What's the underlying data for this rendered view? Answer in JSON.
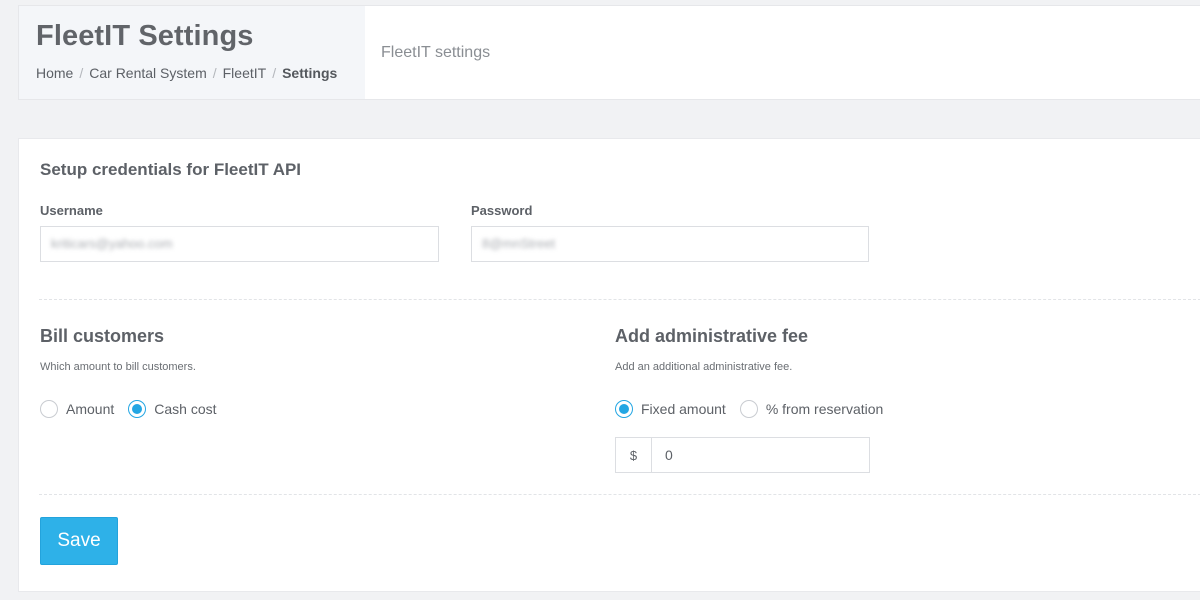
{
  "header": {
    "title": "FleetIT Settings",
    "breadcrumb": [
      "Home",
      "Car Rental System",
      "FleetIT",
      "Settings"
    ],
    "subtitle": "FleetIT settings"
  },
  "credentials": {
    "title": "Setup credentials for FleetIT API",
    "username_label": "Username",
    "username_value": "kriticars@yahoo.com",
    "password_label": "Password",
    "password_value": "8@mnStreet"
  },
  "bill_customers": {
    "title": "Bill customers",
    "help": "Which amount to bill customers.",
    "options": [
      "Amount",
      "Cash cost"
    ],
    "selected": "Cash cost"
  },
  "admin_fee": {
    "title": "Add administrative fee",
    "help": "Add an additional administrative fee.",
    "options": [
      "Fixed amount",
      "% from reservation"
    ],
    "selected": "Fixed amount",
    "currency_symbol": "$",
    "amount_value": "0"
  },
  "actions": {
    "save_label": "Save"
  },
  "colors": {
    "accent": "#2eb1e8",
    "radio_checked": "#23a6e3"
  }
}
